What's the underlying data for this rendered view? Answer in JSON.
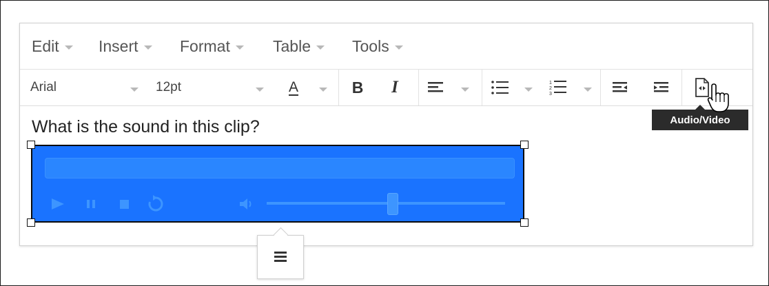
{
  "menubar": {
    "items": [
      {
        "label": "Edit"
      },
      {
        "label": "Insert"
      },
      {
        "label": "Format"
      },
      {
        "label": "Table"
      },
      {
        "label": "Tools"
      }
    ]
  },
  "toolbar": {
    "font_family": "Arial",
    "font_size": "12pt",
    "font_color_glyph": "A",
    "bold_glyph": "B",
    "italic_glyph": "I",
    "active_button_tooltip": "Audio/Video"
  },
  "content": {
    "prompt_text": "What is the sound in this clip?"
  },
  "media_player": {
    "volume_level": 0.53
  },
  "colors": {
    "media_bg": "#1a73ff",
    "tooltip_bg": "#2b2b2b"
  }
}
